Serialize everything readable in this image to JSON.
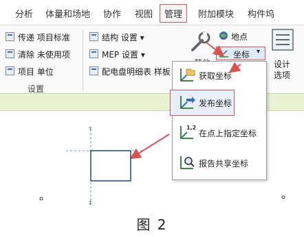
{
  "ribbon": {
    "tabs": [
      "分析",
      "体量和场地",
      "协作",
      "视图",
      "管理",
      "附加模块",
      "构件坞"
    ],
    "col1": [
      "传递 项目标准",
      "清除 未使用项",
      "项目 单位"
    ],
    "col2": [
      "结构 设置",
      "MEP 设置",
      "配电盘明细表 样板"
    ],
    "group_label": "设置",
    "other": "其他",
    "location": "地点",
    "coordinates": "坐标",
    "design_options_1": "设计",
    "design_options_2": "选项"
  },
  "coord_menu": {
    "items": [
      "获取坐标",
      "发布坐标",
      "在点上指定坐标",
      "报告共享坐标"
    ]
  },
  "caption": "图 2",
  "colors": {
    "highlight": "#d9534f",
    "accent": "#3d6fb0",
    "green_bar": "#e9f2d3"
  }
}
